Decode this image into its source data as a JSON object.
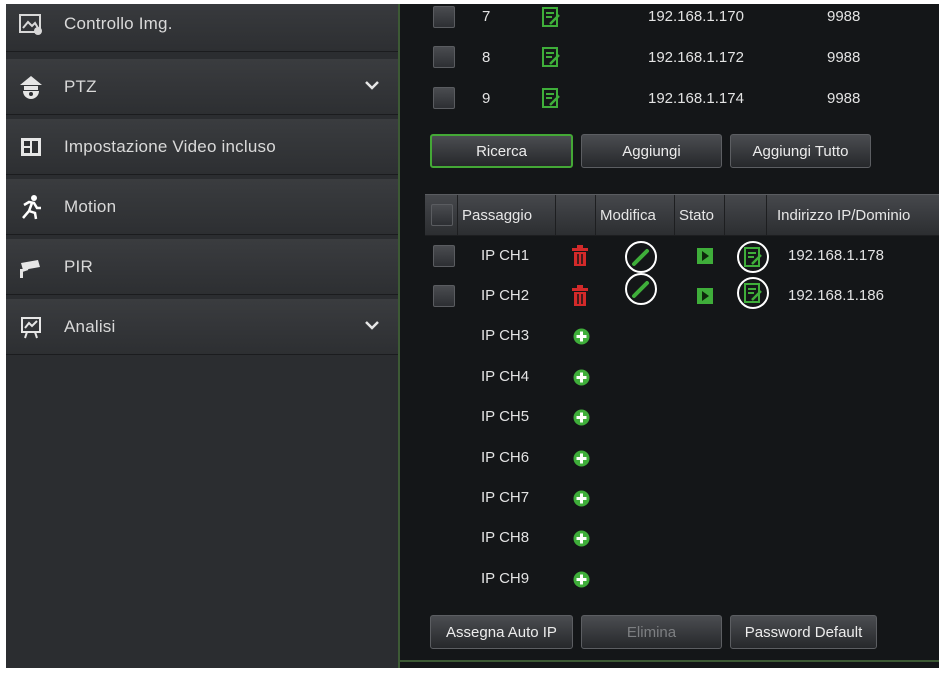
{
  "sidebar": {
    "items": [
      {
        "label": "Controllo Img.",
        "icon": "image-settings-icon",
        "chevron": false
      },
      {
        "label": "PTZ",
        "icon": "ptz-camera-icon",
        "chevron": true
      },
      {
        "label": "Impostazione Video incluso",
        "icon": "video-overlay-icon",
        "chevron": false
      },
      {
        "label": "Motion",
        "icon": "running-person-icon",
        "chevron": false
      },
      {
        "label": "PIR",
        "icon": "security-camera-icon",
        "chevron": false
      },
      {
        "label": "Analisi",
        "icon": "analytics-board-icon",
        "chevron": true
      }
    ]
  },
  "search_results": [
    {
      "num": "7",
      "ip": "192.168.1.170",
      "port": "9988"
    },
    {
      "num": "8",
      "ip": "192.168.1.172",
      "port": "9988"
    },
    {
      "num": "9",
      "ip": "192.168.1.174",
      "port": "9988"
    }
  ],
  "buttons": {
    "search": "Ricerca",
    "add": "Aggiungi",
    "add_all": "Aggiungi Tutto",
    "auto_ip": "Assegna Auto IP",
    "delete": "Elimina",
    "default_password": "Password Default"
  },
  "table": {
    "headers": {
      "channel": "Passaggio",
      "edit": "Modifica",
      "status": "Stato",
      "address": "Indirizzo IP/Dominio"
    },
    "rows": [
      {
        "channel": "IP CH1",
        "action": "delete",
        "ip": "192.168.1.178"
      },
      {
        "channel": "IP CH2",
        "action": "delete",
        "ip": "192.168.1.186"
      },
      {
        "channel": "IP CH3",
        "action": "add",
        "ip": ""
      },
      {
        "channel": "IP CH4",
        "action": "add",
        "ip": ""
      },
      {
        "channel": "IP CH5",
        "action": "add",
        "ip": ""
      },
      {
        "channel": "IP CH6",
        "action": "add",
        "ip": ""
      },
      {
        "channel": "IP CH7",
        "action": "add",
        "ip": ""
      },
      {
        "channel": "IP CH8",
        "action": "add",
        "ip": ""
      },
      {
        "channel": "IP CH9",
        "action": "add",
        "ip": ""
      }
    ]
  },
  "colors": {
    "accent_green": "#44a836",
    "delete_red": "#d42a2a",
    "add_green": "#3fae3a"
  }
}
